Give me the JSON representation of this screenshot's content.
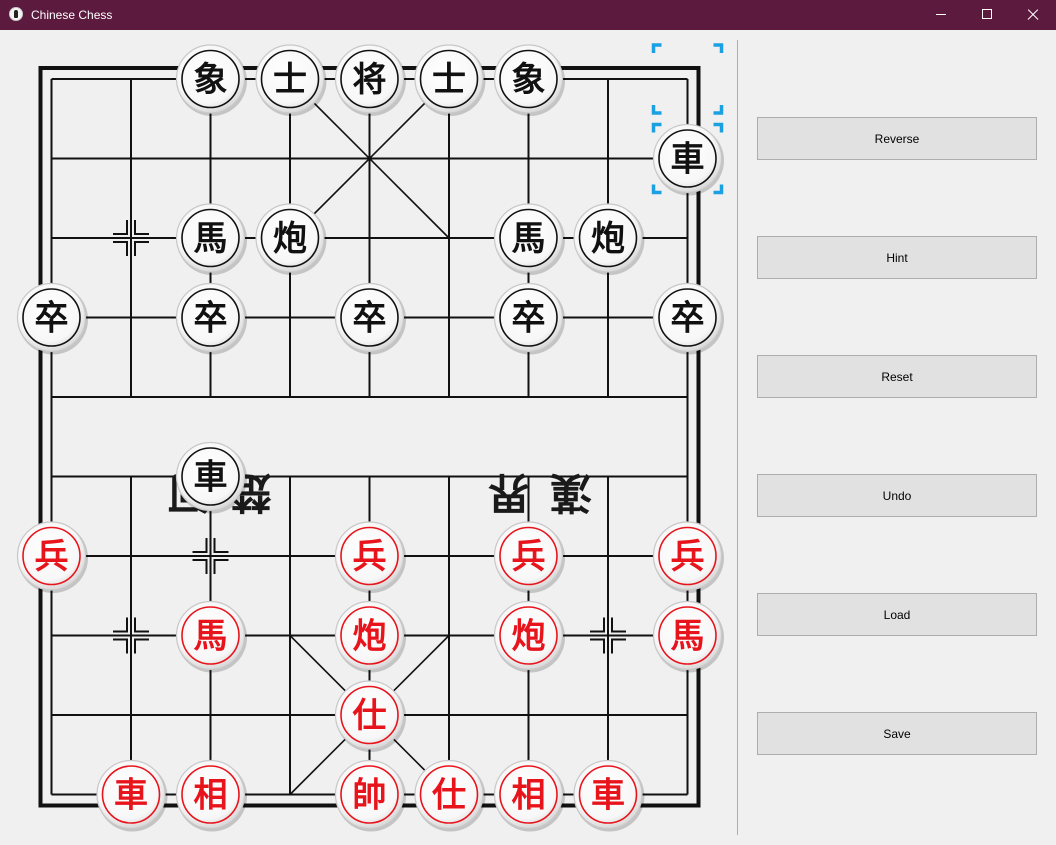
{
  "window": {
    "title": "Chinese Chess"
  },
  "controls": {
    "reverse": "Reverse",
    "hint": "Hint",
    "reset": "Reset",
    "undo": "Undo",
    "load": "Load",
    "save": "Save"
  },
  "colors": {
    "titlebar": "#5c1a3e",
    "red_piece": "#e8141c",
    "black_piece": "#111111",
    "selection": "#1ba1e2"
  },
  "board": {
    "files": 9,
    "ranks": 10,
    "river_text_left": "楚河",
    "river_text_right": "漢界",
    "selected": {
      "file": 8,
      "rank": 1
    },
    "move_from": {
      "file": 8,
      "rank": 0
    },
    "pieces": [
      {
        "side": "black",
        "char": "象",
        "file": 2,
        "rank": 0
      },
      {
        "side": "black",
        "char": "士",
        "file": 3,
        "rank": 0
      },
      {
        "side": "black",
        "char": "将",
        "file": 4,
        "rank": 0
      },
      {
        "side": "black",
        "char": "士",
        "file": 5,
        "rank": 0
      },
      {
        "side": "black",
        "char": "象",
        "file": 6,
        "rank": 0
      },
      {
        "side": "black",
        "char": "車",
        "file": 8,
        "rank": 1
      },
      {
        "side": "black",
        "char": "馬",
        "file": 2,
        "rank": 2
      },
      {
        "side": "black",
        "char": "炮",
        "file": 3,
        "rank": 2
      },
      {
        "side": "black",
        "char": "馬",
        "file": 6,
        "rank": 2
      },
      {
        "side": "black",
        "char": "炮",
        "file": 7,
        "rank": 2
      },
      {
        "side": "black",
        "char": "卒",
        "file": 0,
        "rank": 3
      },
      {
        "side": "black",
        "char": "卒",
        "file": 2,
        "rank": 3
      },
      {
        "side": "black",
        "char": "卒",
        "file": 4,
        "rank": 3
      },
      {
        "side": "black",
        "char": "卒",
        "file": 6,
        "rank": 3
      },
      {
        "side": "black",
        "char": "卒",
        "file": 8,
        "rank": 3
      },
      {
        "side": "black",
        "char": "車",
        "file": 2,
        "rank": 5
      },
      {
        "side": "red",
        "char": "兵",
        "file": 0,
        "rank": 6
      },
      {
        "side": "red",
        "char": "兵",
        "file": 4,
        "rank": 6
      },
      {
        "side": "red",
        "char": "兵",
        "file": 6,
        "rank": 6
      },
      {
        "side": "red",
        "char": "兵",
        "file": 8,
        "rank": 6
      },
      {
        "side": "red",
        "char": "馬",
        "file": 2,
        "rank": 7
      },
      {
        "side": "red",
        "char": "炮",
        "file": 4,
        "rank": 7
      },
      {
        "side": "red",
        "char": "炮",
        "file": 6,
        "rank": 7
      },
      {
        "side": "red",
        "char": "馬",
        "file": 8,
        "rank": 7
      },
      {
        "side": "red",
        "char": "仕",
        "file": 4,
        "rank": 8
      },
      {
        "side": "red",
        "char": "車",
        "file": 1,
        "rank": 9
      },
      {
        "side": "red",
        "char": "相",
        "file": 2,
        "rank": 9
      },
      {
        "side": "red",
        "char": "帥",
        "file": 4,
        "rank": 9
      },
      {
        "side": "red",
        "char": "仕",
        "file": 5,
        "rank": 9
      },
      {
        "side": "red",
        "char": "相",
        "file": 6,
        "rank": 9
      },
      {
        "side": "red",
        "char": "車",
        "file": 7,
        "rank": 9
      }
    ]
  }
}
